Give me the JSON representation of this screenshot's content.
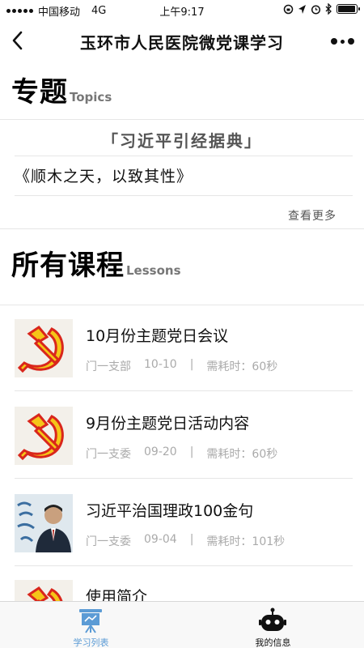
{
  "status_bar": {
    "carrier": "中国移动",
    "network": "4G",
    "time": "上午9:17",
    "battery_level": 0.95
  },
  "nav": {
    "title": "玉环市人民医院微党课学习"
  },
  "topics_section": {
    "heading": "专题",
    "heading_en": "Topics",
    "topic_title": "「习近平引经据典」",
    "topic_item": "《顺木之天，以致其性》",
    "see_more": "查看更多"
  },
  "lessons_section": {
    "heading": "所有课程",
    "heading_en": "Lessons",
    "lessons": [
      {
        "title": "10月份主题党日会议",
        "dept": "门一支部",
        "date": "10-10",
        "sep": "|",
        "duration": "需耗时：60秒",
        "thumb": "party-emblem"
      },
      {
        "title": "9月份主题党日活动内容",
        "dept": "门一支委",
        "date": "09-20",
        "sep": "|",
        "duration": "需耗时：60秒",
        "thumb": "party-emblem"
      },
      {
        "title": "习近平治国理政100金句",
        "dept": "门一支委",
        "date": "09-04",
        "sep": "|",
        "duration": "需耗时：101秒",
        "thumb": "portrait-photo"
      },
      {
        "title": "使用简介",
        "thumb": "party-emblem"
      }
    ]
  },
  "tab_bar": {
    "tabs": [
      {
        "label": "学习列表",
        "icon": "presentation-board-icon",
        "active": true
      },
      {
        "label": "我的信息",
        "icon": "robot-icon",
        "active": false
      }
    ],
    "active_color": "#5b9bd5",
    "inactive_color": "#111111"
  },
  "theme": {
    "party_red": "#d9261c",
    "party_gold": "#f5c518"
  }
}
